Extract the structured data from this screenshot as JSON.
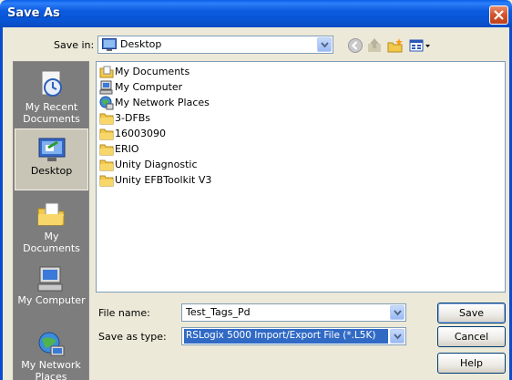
{
  "window": {
    "title": "Save As"
  },
  "save_in": {
    "label": "Save in:",
    "value": "Desktop"
  },
  "toolbar": {
    "icons": [
      "back-icon",
      "up-folder-icon",
      "new-folder-icon",
      "views-menu-icon"
    ]
  },
  "places": [
    {
      "label": "My Recent Documents",
      "icon": "recent-documents-icon"
    },
    {
      "label": "Desktop",
      "icon": "desktop-icon",
      "selected": true
    },
    {
      "label": "My Documents",
      "icon": "my-documents-icon"
    },
    {
      "label": "My Computer",
      "icon": "my-computer-icon"
    },
    {
      "label": "My Network Places",
      "icon": "network-places-icon"
    }
  ],
  "files": [
    {
      "name": "My Documents",
      "icon": "my-documents-icon"
    },
    {
      "name": "My Computer",
      "icon": "my-computer-icon"
    },
    {
      "name": "My Network Places",
      "icon": "network-places-icon"
    },
    {
      "name": "3-DFBs",
      "icon": "folder-icon"
    },
    {
      "name": "16003090",
      "icon": "folder-icon"
    },
    {
      "name": "ERIO",
      "icon": "folder-icon"
    },
    {
      "name": "Unity Diagnostic",
      "icon": "folder-icon"
    },
    {
      "name": "Unity EFBToolkit V3",
      "icon": "folder-icon"
    }
  ],
  "file_name": {
    "label": "File name:",
    "value": "Test_Tags_Pd"
  },
  "save_as_type": {
    "label": "Save as type:",
    "value": "RSLogix 5000 Import/Export File (*.L5K)"
  },
  "buttons": {
    "save": "Save",
    "cancel": "Cancel",
    "help": "Help"
  },
  "colors": {
    "title_bar": "#0a5fe8",
    "selection": "#316ac5",
    "dialog_bg": "#ece9d8"
  }
}
